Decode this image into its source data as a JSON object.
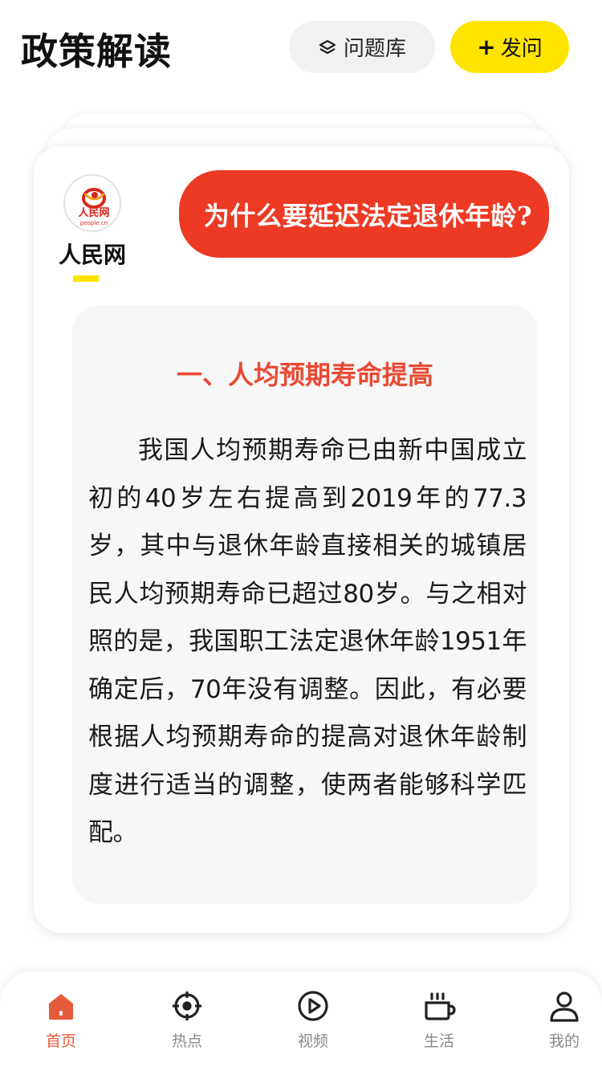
{
  "header": {
    "title": "政策解读",
    "question_bank_label": "问题库",
    "ask_label": "发问",
    "ask_plus": "+"
  },
  "card": {
    "source": {
      "name": "人民网",
      "logo_text": "人民网",
      "logo_subtext": "people.cn"
    },
    "question": "为什么要延迟法定退休年龄?",
    "section_heading": "一、人均预期寿命提高",
    "body": "我国人均预期寿命已由新中国成立初的40岁左右提高到2019年的77.3岁，其中与退休年龄直接相关的城镇居民人均预期寿命已超过80岁。与之相对照的是，我国职工法定退休年龄1951年确定后，70年没有调整。因此，有必要根据人均预期寿命的提高对退休年龄制度进行适当的调整，使两者能够科学匹配。"
  },
  "nav": {
    "items": [
      {
        "label": "首页",
        "icon": "home-icon",
        "active": true
      },
      {
        "label": "热点",
        "icon": "crosshair-icon",
        "active": false
      },
      {
        "label": "视频",
        "icon": "play-icon",
        "active": false
      },
      {
        "label": "生活",
        "icon": "cup-icon",
        "active": false
      },
      {
        "label": "我的",
        "icon": "user-icon",
        "active": false
      }
    ]
  },
  "colors": {
    "accent_yellow": "#ffe400",
    "question_red": "#ec3a24",
    "heading_red": "#e94a35",
    "nav_active": "#e55a3a",
    "nav_inactive": "#888888"
  }
}
